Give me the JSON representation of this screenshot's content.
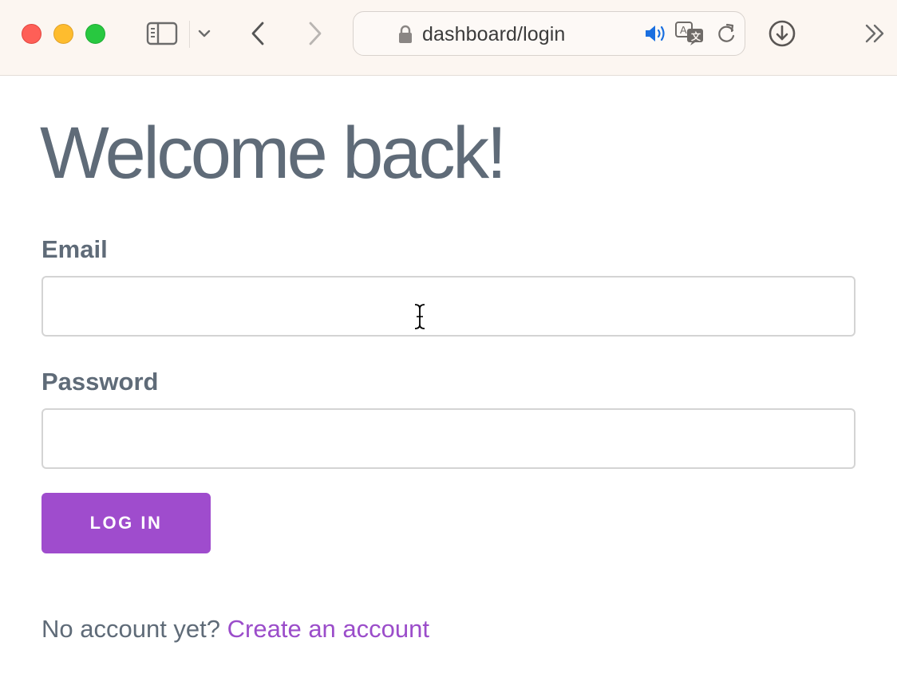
{
  "browser": {
    "url": "dashboard/login",
    "icons": {
      "sidebar": "sidebar-icon",
      "tab_menu": "chevron-down-icon",
      "back": "chevron-left-icon",
      "forward": "chevron-right-icon",
      "secure": "lock-icon",
      "audio": "speaker-icon",
      "translate": "translate-icon",
      "reload": "reload-icon",
      "downloads": "download-icon",
      "overflow": "double-chevron-right-icon"
    },
    "colors": {
      "toolbar_bg": "#fcf6f1",
      "close": "#fe5f57",
      "minimize": "#febc2e",
      "maximize": "#28c840",
      "audio_accent": "#1a6fe0"
    }
  },
  "page": {
    "title": "Welcome back!",
    "email": {
      "label": "Email",
      "value": "",
      "placeholder": ""
    },
    "password": {
      "label": "Password",
      "value": "",
      "placeholder": ""
    },
    "login_button": "LOG IN",
    "signup_prompt": "No account yet?",
    "signup_link": "Create an account",
    "colors": {
      "text": "#5f6b78",
      "accent": "#9f4ccd",
      "link": "#9b4dca"
    }
  }
}
